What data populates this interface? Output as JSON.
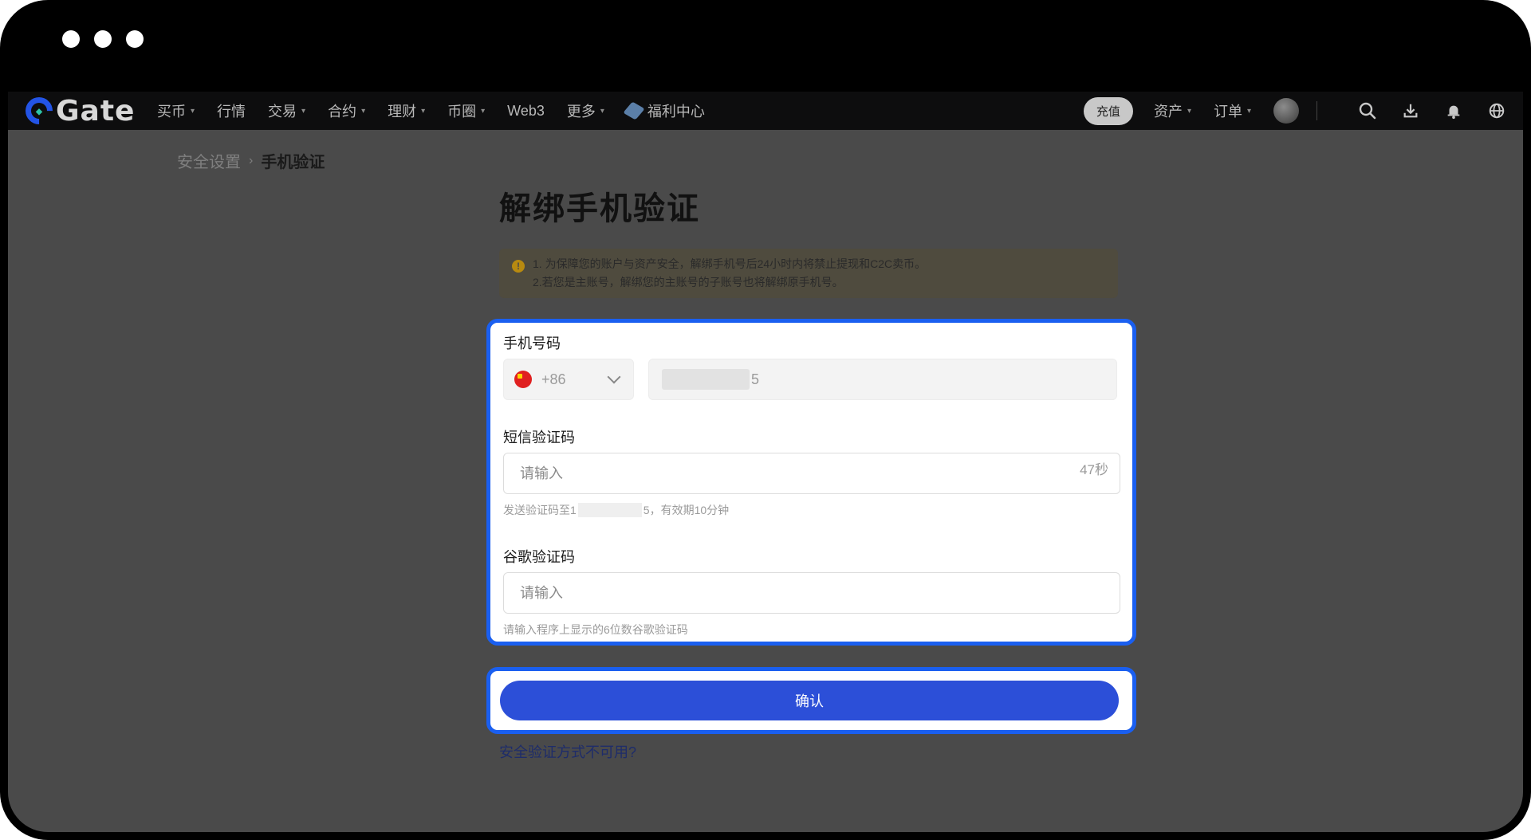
{
  "nav": {
    "logo_text": "Gate",
    "menu": [
      {
        "label": "买币",
        "caret": true
      },
      {
        "label": "行情",
        "caret": false
      },
      {
        "label": "交易",
        "caret": true
      },
      {
        "label": "合约",
        "caret": true
      },
      {
        "label": "理财",
        "caret": true
      },
      {
        "label": "币圈",
        "caret": true
      },
      {
        "label": "Web3",
        "caret": false
      },
      {
        "label": "更多",
        "caret": true
      }
    ],
    "welfare_label": "福利中心",
    "deposit_label": "充值",
    "assets_label": "资产",
    "orders_label": "订单",
    "caret_symbol": "▾"
  },
  "breadcrumb": {
    "parent": "安全设置",
    "separator": "›",
    "current": "手机验证"
  },
  "page_title": "解绑手机验证",
  "notice": {
    "icon": "!",
    "line1": "1. 为保障您的账户与资产安全，解绑手机号后24小时内将禁止提现和C2C卖币。",
    "line2": "2.若您是主账号，解绑您的主账号的子账号也将解绑原手机号。"
  },
  "form": {
    "phone_label": "手机号码",
    "country_code": "+86",
    "phone_suffix": "5",
    "sms_label": "短信验证码",
    "sms_placeholder": "请输入",
    "sms_countdown": "47秒",
    "sms_hint_prefix": "发送验证码至1",
    "sms_hint_suffix": "5，有效期10分钟",
    "google_label": "谷歌验证码",
    "google_placeholder": "请输入",
    "google_hint": "请输入程序上显示的6位数谷歌验证码"
  },
  "confirm_label": "确认",
  "unavailable_link": "安全验证方式不可用?",
  "colors": {
    "highlight": "#1a5ff0",
    "primary_button": "#2c4fd8"
  }
}
